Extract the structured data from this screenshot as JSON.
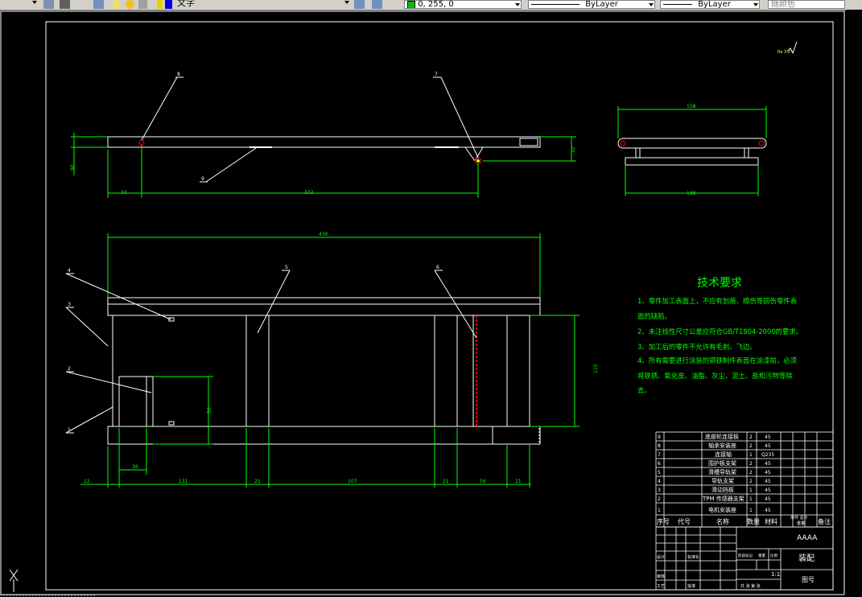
{
  "toolbar": {
    "text_style": "文字",
    "color_value": "0, 255, 0",
    "linetype": "ByLayer",
    "lineweight": "ByLayer",
    "plot_style": "随颜色",
    "color_swatch": "#00c000"
  },
  "drawing": {
    "tech_title": "技术要求",
    "tech_lines": [
      "1、零件加工表面上，不应有划痕、擦伤等损伤零件表",
      "面的缺陷。",
      "2、未注线性尺寸公差应符合GB/T1804-2000的要求。",
      "3、加工后的零件不允许有毛刺、飞边。",
      "4、所有需要进行涂装的钢铁制件表面在涂漆前，必须",
      "将铁锈、氧化皮、油脂、灰尘、泥土、盐和污物等除",
      "去。"
    ],
    "roughness": "Ra 3.2",
    "dims": {
      "d_side_w": "158",
      "d_side_w2": "138",
      "d_top_left": "34",
      "d_top_mid": "342",
      "d_top_h": "90",
      "d_top_right": "32",
      "d_main_total": "430",
      "d_main_h": "110",
      "d_inner_h": "50",
      "d_inner_w": "36",
      "d_b1": "12",
      "d_b2": "131",
      "d_b3": "21",
      "d_b4": "107",
      "d_b5": "21",
      "d_b6": "56",
      "d_b7": "21"
    },
    "callouts": [
      "1",
      "2",
      "3",
      "4",
      "5",
      "6",
      "7",
      "8",
      "9"
    ],
    "bom_rows": [
      {
        "no": "9",
        "name": "底部轮连接板",
        "qty": "2",
        "mat": "45"
      },
      {
        "no": "8",
        "name": "轴承安装座",
        "qty": "2",
        "mat": "45"
      },
      {
        "no": "7",
        "name": "连接轴",
        "qty": "1",
        "mat": "Q235"
      },
      {
        "no": "6",
        "name": "围护板支架",
        "qty": "2",
        "mat": "45"
      },
      {
        "no": "5",
        "name": "滑槽导轨架",
        "qty": "2",
        "mat": "45"
      },
      {
        "no": "4",
        "name": "导轨支架",
        "qty": "2",
        "mat": "45"
      },
      {
        "no": "3",
        "name": "滑动挡板",
        "qty": "1",
        "mat": "45"
      },
      {
        "no": "2",
        "name": "TPM 传感器支架",
        "qty": "1",
        "mat": "45"
      },
      {
        "no": "1",
        "name": "电机安装座",
        "qty": "1",
        "mat": "45"
      }
    ],
    "bom_header": {
      "no": "序号",
      "code": "代号",
      "name": "名称",
      "qty": "数量",
      "mat": "材料",
      "unit_w": "单件 总计",
      "weight": "重量",
      "note": "备注"
    },
    "title_block": {
      "title": "AAAA",
      "part": "装配",
      "drawing_no": "图号",
      "scale": "1:1",
      "sheets": "共 张 第 张",
      "designer": "设计",
      "checker": "审核",
      "process": "工艺",
      "approve": "批准",
      "standardize": "标准化",
      "stage": "阶段标记",
      "weight": "重量",
      "ratio": "比例"
    }
  }
}
